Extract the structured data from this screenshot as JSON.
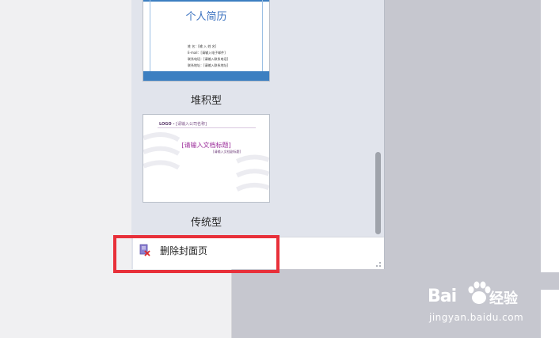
{
  "gallery": {
    "items": [
      {
        "label": "堆积型",
        "thumb": {
          "title": "个人简历",
          "lines": [
            "姓 名：[输 入 姓 名]",
            "E-mail：[请输入电子邮件]",
            "联系电话：[请输入联系电话]",
            "联系地址：[请输入联系地址]"
          ]
        }
      },
      {
        "label": "传统型",
        "thumb": {
          "header_logo": "LOGO -",
          "header_text": "[请输入公司名称]",
          "title": "[请输入文档标题]",
          "subtitle": "[请输入文档副标题]"
        }
      }
    ]
  },
  "footer": {
    "remove_cover_label": "删除封面页",
    "remove_cover_icon": "delete-page-icon"
  },
  "watermark": {
    "brand": "Bai",
    "suffix": "经验",
    "url": "jingyan.baidu.com"
  },
  "colors": {
    "highlight": "#e8303a",
    "thumb_blue": "#3c7fc1",
    "thumb_purple": "#9b2c9a"
  }
}
